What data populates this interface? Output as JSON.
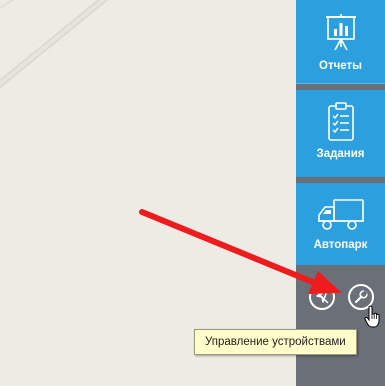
{
  "sidebar": {
    "items": [
      {
        "label": "Отчеты",
        "icon": "presentation-board-icon"
      },
      {
        "label": "Задания",
        "icon": "clipboard-checklist-icon"
      },
      {
        "label": "Автопарк",
        "icon": "truck-icon"
      }
    ],
    "actions": [
      {
        "icon": "navigation-arrow-off-icon"
      },
      {
        "icon": "wrench-icon"
      }
    ]
  },
  "tooltip": {
    "text": "Управление устройствами"
  },
  "colors": {
    "sidebar_bg": "#6a6f78",
    "nav_button": "#2c9fdf",
    "map_bg": "#eeebe5",
    "tooltip_bg": "#fffeca",
    "annotation_arrow": "#ee1c1c"
  }
}
